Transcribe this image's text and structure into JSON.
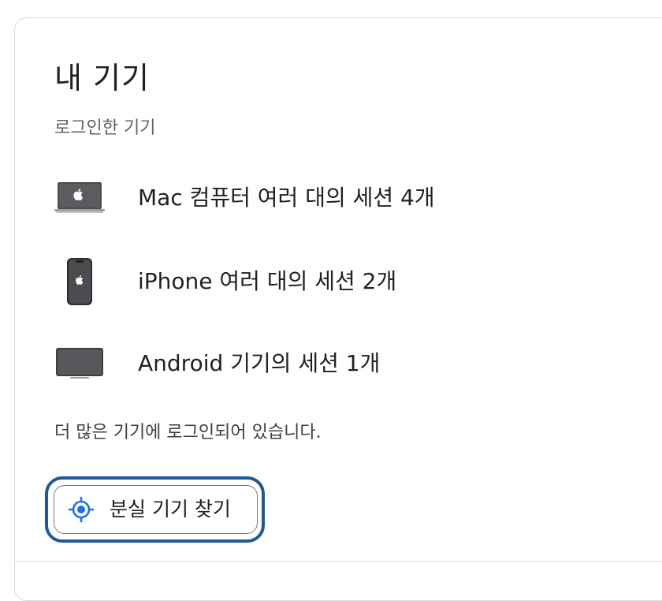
{
  "section": {
    "title": "내 기기",
    "subtitle": "로그인한 기기"
  },
  "devices": [
    {
      "label": "Mac 컴퓨터 여러 대의 세션 4개",
      "icon": "macbook-icon"
    },
    {
      "label": "iPhone 여러 대의 세션 2개",
      "icon": "iphone-icon"
    },
    {
      "label": "Android 기기의 세션 1개",
      "icon": "android-tablet-icon"
    }
  ],
  "more_text": "더 많은 기기에 로그인되어 있습니다.",
  "find_device_button": {
    "label": "분실 기기 찾기",
    "icon": "locate-icon"
  },
  "colors": {
    "accent": "#1a73e8",
    "focus_ring": "#1e5a96",
    "border": "#dadce0"
  }
}
